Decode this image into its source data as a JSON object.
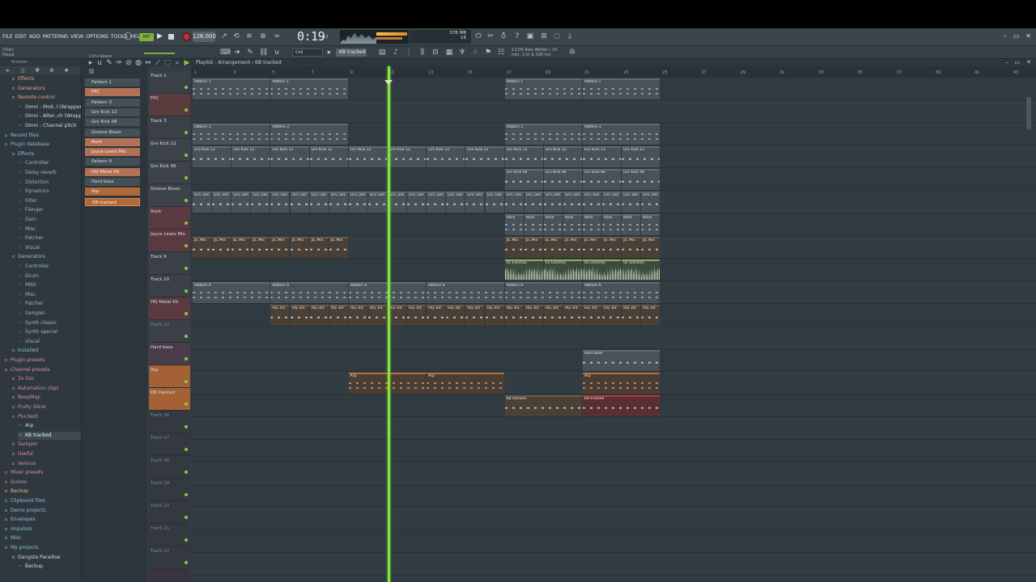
{
  "menu": [
    "FILE",
    "EDIT",
    "ADD",
    "PATTERNS",
    "VIEW",
    "OPTIONS",
    "TOOLS",
    "HELP"
  ],
  "transport": {
    "pat_label": "PAT",
    "tempo": "126.000",
    "time": "0:19",
    "time_small": "07",
    "cpu": "378 MB",
    "cpu2": "16"
  },
  "hint": {
    "line1": "(Tick)",
    "line2": "Pause",
    "shortcut": "Ctrl+Space",
    "panel_line1": "13:04  Alex Welker | 10",
    "panel_line2": "min, 1 hr & 100 hrs"
  },
  "toolbar2": {
    "snap": "Cell",
    "pattern": "KB tracked"
  },
  "browser": {
    "head": "Browser",
    "items": [
      {
        "label": "Effects",
        "indent": 1,
        "style": "hl"
      },
      {
        "label": "Generators",
        "indent": 1,
        "style": "hl"
      },
      {
        "label": "Remote control",
        "indent": 1,
        "style": "hl"
      },
      {
        "label": "Omni - Mod..l (Wrapper)",
        "indent": 2,
        "style": "open"
      },
      {
        "label": "Omni - Alter..ch (Wrapper)",
        "indent": 2,
        "style": "open"
      },
      {
        "label": "Omni - Channel pitch",
        "indent": 2,
        "style": "open"
      },
      {
        "label": "Recent files",
        "indent": 0,
        "style": "folder"
      },
      {
        "label": "Plugin database",
        "indent": 0,
        "style": "folder"
      },
      {
        "label": "Effects",
        "indent": 1,
        "style": "folder"
      },
      {
        "label": "Controller",
        "indent": 2,
        "style": ""
      },
      {
        "label": "Delay reverb",
        "indent": 2,
        "style": ""
      },
      {
        "label": "Distortion",
        "indent": 2,
        "style": ""
      },
      {
        "label": "Dynamics",
        "indent": 2,
        "style": ""
      },
      {
        "label": "Filter",
        "indent": 2,
        "style": ""
      },
      {
        "label": "Flanger",
        "indent": 2,
        "style": ""
      },
      {
        "label": "Gain",
        "indent": 2,
        "style": ""
      },
      {
        "label": "Misc",
        "indent": 2,
        "style": ""
      },
      {
        "label": "Patcher",
        "indent": 2,
        "style": ""
      },
      {
        "label": "Visual",
        "indent": 2,
        "style": ""
      },
      {
        "label": "Generators",
        "indent": 1,
        "style": "folder"
      },
      {
        "label": "Controller",
        "indent": 2,
        "style": ""
      },
      {
        "label": "Drum",
        "indent": 2,
        "style": ""
      },
      {
        "label": "MIDI",
        "indent": 2,
        "style": ""
      },
      {
        "label": "Misc",
        "indent": 2,
        "style": ""
      },
      {
        "label": "Patcher",
        "indent": 2,
        "style": ""
      },
      {
        "label": "Sampler",
        "indent": 2,
        "style": ""
      },
      {
        "label": "Synth classic",
        "indent": 2,
        "style": ""
      },
      {
        "label": "Synth special",
        "indent": 2,
        "style": ""
      },
      {
        "label": "Visual",
        "indent": 2,
        "style": ""
      },
      {
        "label": "Installed",
        "indent": 1,
        "style": "folder"
      },
      {
        "label": "Plugin presets",
        "indent": 0,
        "style": "pink"
      },
      {
        "label": "Channel presets",
        "indent": 0,
        "style": "pink"
      },
      {
        "label": "3x Osc",
        "indent": 1,
        "style": "pink"
      },
      {
        "label": "Automation clips",
        "indent": 1,
        "style": "pink"
      },
      {
        "label": "BeepMap",
        "indent": 1,
        "style": "pink"
      },
      {
        "label": "Fruity Slicer",
        "indent": 1,
        "style": "pink"
      },
      {
        "label": "Plucked!",
        "indent": 1,
        "style": "pink"
      },
      {
        "label": "Arp",
        "indent": 2,
        "style": "open"
      },
      {
        "label": "KB tracked",
        "indent": 2,
        "style": "sel"
      },
      {
        "label": "Sampler",
        "indent": 1,
        "style": "pink"
      },
      {
        "label": "Useful",
        "indent": 1,
        "style": "pink"
      },
      {
        "label": "Various",
        "indent": 1,
        "style": "pink"
      },
      {
        "label": "Mixer presets",
        "indent": 0,
        "style": "pink"
      },
      {
        "label": "Scores",
        "indent": 0,
        "style": "pink"
      },
      {
        "label": "Backup",
        "indent": 0,
        "style": "yellow"
      },
      {
        "label": "Clipboard files",
        "indent": 0,
        "style": "folder"
      },
      {
        "label": "Demo projects",
        "indent": 0,
        "style": "folder"
      },
      {
        "label": "Envelopes",
        "indent": 0,
        "style": "folder"
      },
      {
        "label": "Impulses",
        "indent": 0,
        "style": "folder"
      },
      {
        "label": "Misc",
        "indent": 0,
        "style": "folder"
      },
      {
        "label": "My projects",
        "indent": 0,
        "style": "folder"
      },
      {
        "label": "Gangsta Paradise",
        "indent": 1,
        "style": "open"
      },
      {
        "label": "Backup",
        "indent": 2,
        "style": "open"
      }
    ]
  },
  "playlist": {
    "title": "Playlist - Arrangement › KB tracked",
    "patterns": [
      {
        "label": "Pattern 1",
        "style": ""
      },
      {
        "label": "FPC",
        "style": "lt"
      },
      {
        "label": "Pattern 3",
        "style": ""
      },
      {
        "label": "Grv Kick 12",
        "style": ""
      },
      {
        "label": "Grv Kick 06",
        "style": ""
      },
      {
        "label": "Groove Blues",
        "style": ""
      },
      {
        "label": "Rock",
        "style": "lt"
      },
      {
        "label": "Jayce Lewis Mix",
        "style": "lt"
      },
      {
        "label": "Pattern 9",
        "style": ""
      },
      {
        "label": "HQ Metal Kit",
        "style": "lt"
      },
      {
        "label": "Hard bass",
        "style": ""
      },
      {
        "label": "Arp",
        "style": "orange"
      },
      {
        "label": "KB tracked",
        "style": "orange active"
      }
    ],
    "tracks": [
      {
        "label": "Track 1",
        "color": "#3b3f48",
        "dim": false
      },
      {
        "label": "FPC",
        "color": "#5b3c3e",
        "dim": false
      },
      {
        "label": "Track 3",
        "color": "#3b3f48",
        "dim": false
      },
      {
        "label": "Grv Kick 12",
        "color": "#3e424b",
        "dim": false
      },
      {
        "label": "Grv Kick 06",
        "color": "#3e424b",
        "dim": false
      },
      {
        "label": "Groove Blues",
        "color": "#3e424b",
        "dim": false
      },
      {
        "label": "Rock",
        "color": "#5a3a40",
        "dim": false
      },
      {
        "label": "Jayce Lewis Mix",
        "color": "#5a3a40",
        "dim": false
      },
      {
        "label": "Track 9",
        "color": "#3b3f48",
        "dim": false
      },
      {
        "label": "Track 10",
        "color": "#3b3f48",
        "dim": false
      },
      {
        "label": "HQ Metal Kit",
        "color": "#5a3a40",
        "dim": false
      },
      {
        "label": "Track 12",
        "color": "#3b3f48",
        "dim": true
      },
      {
        "label": "Hard bass",
        "color": "#4a3c48",
        "dim": false
      },
      {
        "label": "Arp",
        "color": "#a46136",
        "dim": false
      },
      {
        "label": "KB tracked",
        "color": "#a46136",
        "dim": false
      },
      {
        "label": "Track 16",
        "color": "#34393f",
        "dim": true
      },
      {
        "label": "Track 17",
        "color": "#34393f",
        "dim": true
      },
      {
        "label": "Track 18",
        "color": "#34393f",
        "dim": true
      },
      {
        "label": "Track 19",
        "color": "#34393f",
        "dim": true
      },
      {
        "label": "Track 20",
        "color": "#34393f",
        "dim": true
      },
      {
        "label": "Track 21",
        "color": "#34393f",
        "dim": true
      },
      {
        "label": "Track 22",
        "color": "#34393f",
        "dim": true
      }
    ],
    "ticks": [
      "1",
      "3",
      "5",
      "7",
      "9",
      "11",
      "13",
      "15",
      "17",
      "19",
      "21",
      "23",
      "25",
      "27",
      "29",
      "31",
      "33",
      "35",
      "37",
      "39",
      "41",
      "43"
    ],
    "clips": [
      {
        "lane": 0,
        "start": 1,
        "end": 9,
        "seg": 4,
        "label": "Pattern 1",
        "color": "gray",
        "notes": "two"
      },
      {
        "lane": 0,
        "start": 17,
        "end": 25,
        "seg": 4,
        "label": "Pattern 1",
        "color": "gray",
        "notes": "two"
      },
      {
        "lane": 2,
        "start": 1,
        "end": 9,
        "seg": 4,
        "label": "Pattern 3",
        "color": "gray",
        "notes": "two"
      },
      {
        "lane": 2,
        "start": 17,
        "end": 25,
        "seg": 4,
        "label": "Pattern 3",
        "color": "gray",
        "notes": "two"
      },
      {
        "lane": 3,
        "start": 1,
        "end": 25,
        "seg": 2,
        "label": "Grv Kick 12",
        "color": "gray",
        "notes": "one"
      },
      {
        "lane": 4,
        "start": 17,
        "end": 25,
        "seg": 2,
        "label": "Grv Kick 06",
        "color": "gray",
        "notes": "one"
      },
      {
        "lane": 5,
        "start": 1,
        "end": 25,
        "seg": 1,
        "label": "Grv..ues",
        "color": "gray",
        "notes": "one"
      },
      {
        "lane": 6,
        "start": 17,
        "end": 25,
        "seg": 1,
        "label": "Rock",
        "color": "gray",
        "notes": "two"
      },
      {
        "lane": 7,
        "start": 1,
        "end": 9,
        "seg": 1,
        "label": "Ja..Mix",
        "color": "brown",
        "notes": "one"
      },
      {
        "lane": 7,
        "start": 17,
        "end": 25,
        "seg": 1,
        "label": "Ja..Mix",
        "color": "brown",
        "notes": "one"
      },
      {
        "lane": 8,
        "start": 17,
        "end": 25,
        "seg": 2,
        "label": "01 Electron",
        "color": "green",
        "notes": "wave"
      },
      {
        "lane": 9,
        "start": 1,
        "end": 25,
        "seg": 4,
        "label": "Pattern 9",
        "color": "gray",
        "notes": "two"
      },
      {
        "lane": 10,
        "start": 5,
        "end": 25,
        "seg": 1,
        "label": "HQ..Kit",
        "color": "brown",
        "notes": "one"
      },
      {
        "lane": 12,
        "start": 21,
        "end": 25,
        "seg": 4,
        "label": "Hard bass",
        "color": "gray",
        "notes": "one"
      },
      {
        "lane": 13,
        "start": 9,
        "end": 17,
        "seg": 4,
        "label": "Arp",
        "color": "orange",
        "notes": "two"
      },
      {
        "lane": 13,
        "start": 21,
        "end": 25,
        "seg": 4,
        "label": "Arp",
        "color": "orange",
        "notes": "two"
      },
      {
        "lane": 14,
        "start": 17,
        "end": 21,
        "seg": 4,
        "label": "KB tracked",
        "color": "brown",
        "notes": "one"
      },
      {
        "lane": 14,
        "start": 21,
        "end": 25,
        "seg": 4,
        "label": "KB tracked",
        "color": "red",
        "notes": "one"
      }
    ]
  },
  "colors": {
    "accent": "#7fd23a",
    "playhead": "#8be04a",
    "arp": "#b5723f",
    "kbtracked_red": "#c9302f"
  }
}
